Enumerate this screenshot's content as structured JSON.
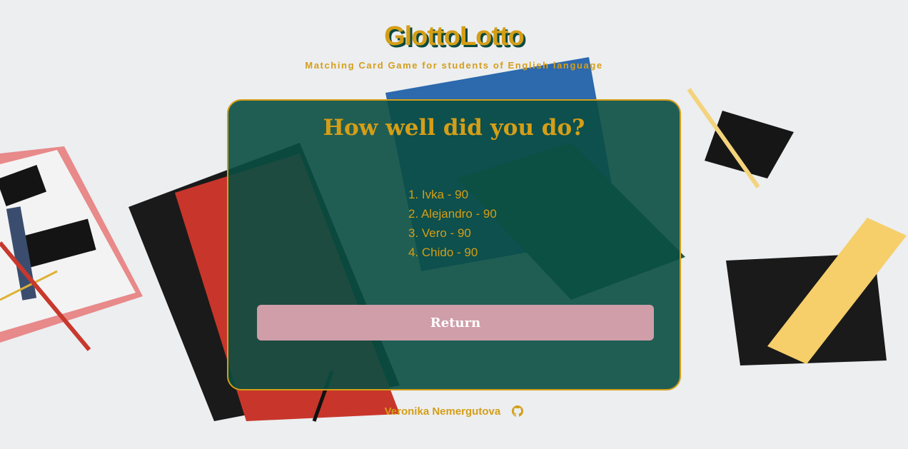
{
  "header": {
    "title": "GlottoLotto",
    "subtitle": "Matching Card Game for students of English language"
  },
  "results": {
    "title": "How well did you do?",
    "scores": [
      "1. Ivka - 90",
      "2. Alejandro - 90",
      "3. Vero - 90",
      "4. Chido - 90"
    ],
    "return_label": "Return"
  },
  "footer": {
    "author": "Veronika Nemergutova",
    "icon": "github-icon"
  },
  "colors": {
    "accent": "#d59e17",
    "card_bg": "#0a4e42",
    "button_bg": "#cf9ea9",
    "page_bg": "#eceef0"
  }
}
